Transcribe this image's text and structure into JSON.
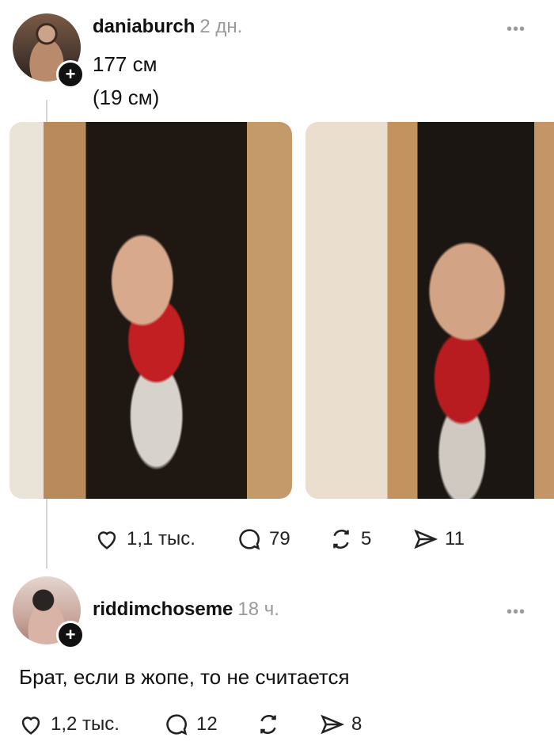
{
  "post1": {
    "username": "daniaburch",
    "time": "2 дн.",
    "more": "•••",
    "text_lines": [
      "177 см",
      "(19 см)"
    ],
    "images": [
      {
        "alt": "mirror selfie photo 1"
      },
      {
        "alt": "mirror selfie photo 2"
      }
    ],
    "stats": {
      "likes": "1,1 тыс.",
      "comments": "79",
      "reposts": "5",
      "shares": "11"
    }
  },
  "post2": {
    "username": "riddimchoseme",
    "time": "18 ч.",
    "more": "•••",
    "text": "Брат, если в жопе, то не считается",
    "stats": {
      "likes": "1,2 тыс.",
      "comments": "12",
      "reposts": "",
      "shares": "8"
    }
  },
  "icons": {
    "plus": "+",
    "heart": "heart-icon",
    "comment": "comment-icon",
    "repost": "repost-icon",
    "share": "share-icon"
  }
}
